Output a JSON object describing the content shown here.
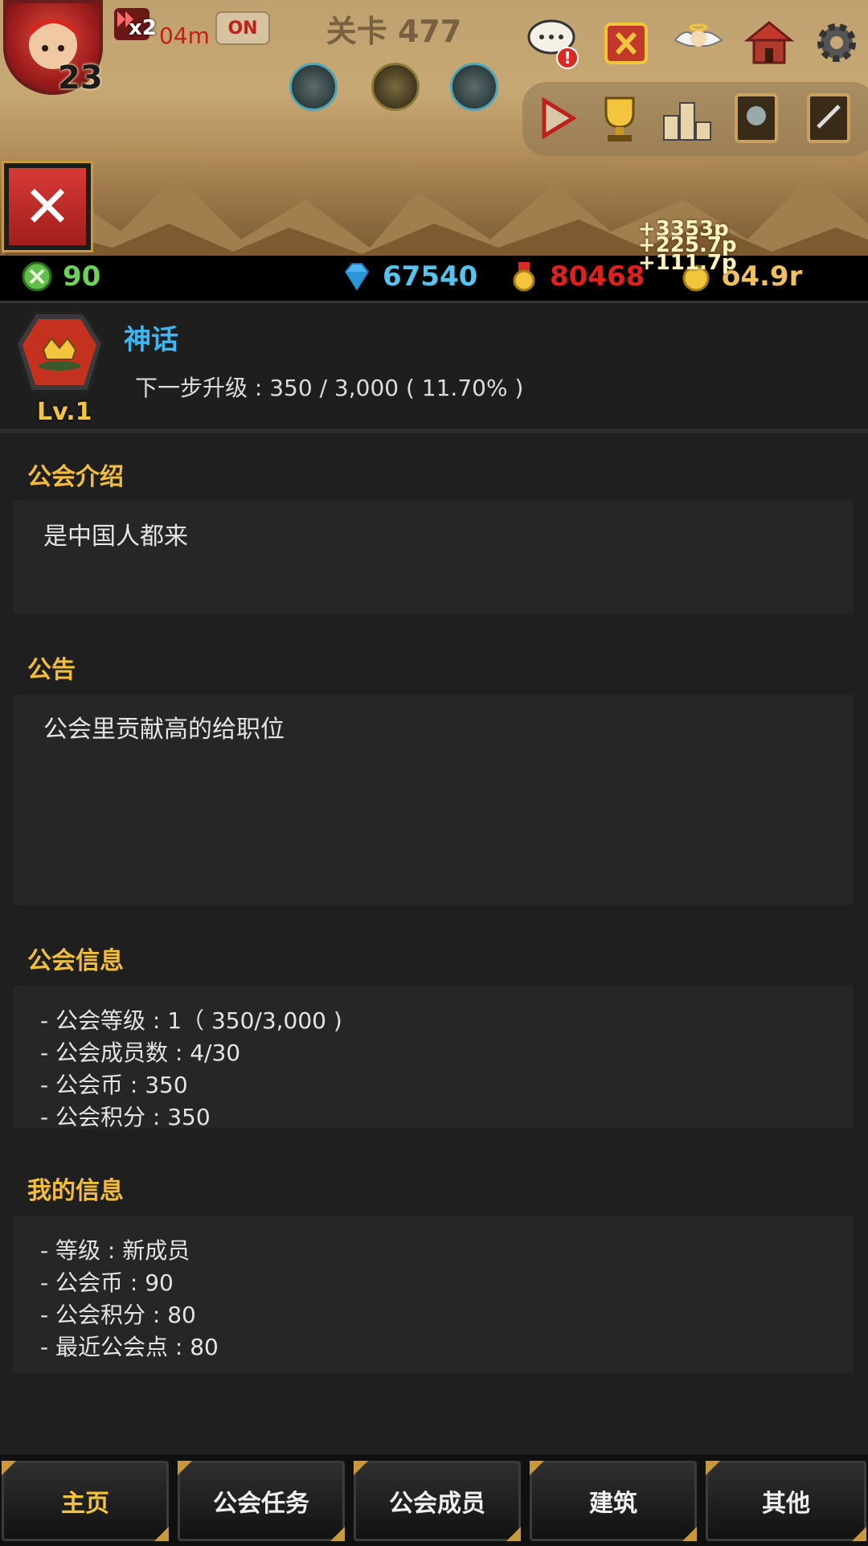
{
  "hud": {
    "player_level": "23",
    "speed_label": "x2",
    "speed_timer": "04m",
    "speed_toggle": "ON",
    "stage_title": "关卡 477",
    "floating_texts": [
      "+3353p",
      "+225.7p",
      "+111.7p"
    ]
  },
  "resources": {
    "guild_coins": "90",
    "gems": "67540",
    "medals": "80468",
    "gold": "o4.9r"
  },
  "guild": {
    "name": "神话",
    "level_label": "Lv.1",
    "progress_text": "下一步升级 : 350 / 3,000 ( 11.70% )",
    "progress_fraction": 0.117
  },
  "sections": {
    "intro": {
      "title": "公会介绍",
      "text": "是中国人都来"
    },
    "notice": {
      "title": "公告",
      "text": "公会里贡献高的给职位"
    },
    "guild_info": {
      "title": "公会信息",
      "lines": [
        "- 公会等级 : 1（ 350/3,000 )",
        "- 公会成员数 : 4/30",
        "- 公会币 : 350",
        "- 公会积分 : 350"
      ]
    },
    "my_info": {
      "title": "我的信息",
      "lines": [
        "- 等级 : 新成员",
        "- 公会币 : 90",
        "- 公会积分 : 80",
        "- 最近公会点 : 80"
      ]
    }
  },
  "nav": {
    "tabs": [
      "主页",
      "公会任务",
      "公会成员",
      "建筑",
      "其他"
    ],
    "active": "主页"
  },
  "colors": {
    "accent_gold": "#f3bd3c",
    "guild_name_blue": "#3fb6f0",
    "close_red": "#d83a35"
  },
  "icons": {
    "top_row": [
      "chat-alert-icon",
      "event-shield-icon",
      "angel-icon",
      "shop-house-icon",
      "gear-icon"
    ],
    "menu_row": [
      "play-icon",
      "trophy-icon",
      "ranking-podium-icon",
      "hero-book-icon",
      "quest-book-icon"
    ]
  }
}
